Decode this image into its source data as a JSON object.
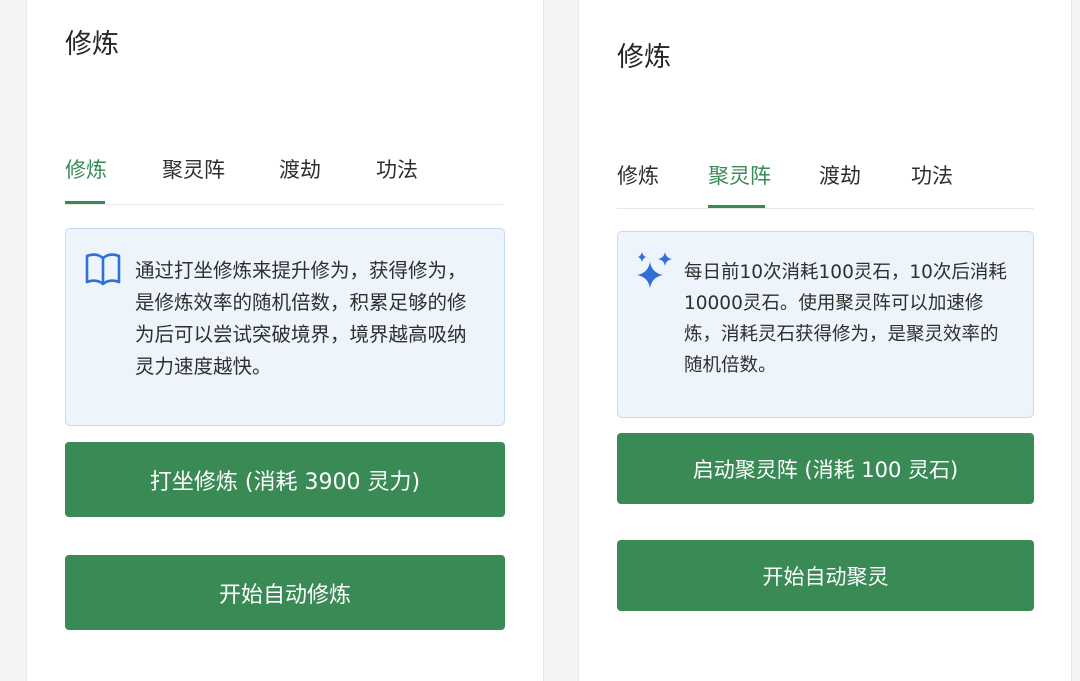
{
  "left_panel": {
    "title": "修炼",
    "tabs": [
      {
        "label": "修炼",
        "active": true
      },
      {
        "label": "聚灵阵",
        "active": false
      },
      {
        "label": "渡劫",
        "active": false
      },
      {
        "label": "功法",
        "active": false
      }
    ],
    "info": {
      "icon": "book-icon",
      "text": "通过打坐修炼来提升修为，获得修为，是修炼效率的随机倍数，积累足够的修为后可以尝试突破境界，境界越高吸纳灵力速度越快。"
    },
    "primary_button": "打坐修炼 (消耗 3900 灵力)",
    "secondary_button": "开始自动修炼"
  },
  "right_panel": {
    "title": "修炼",
    "tabs": [
      {
        "label": "修炼",
        "active": false
      },
      {
        "label": "聚灵阵",
        "active": true
      },
      {
        "label": "渡劫",
        "active": false
      },
      {
        "label": "功法",
        "active": false
      }
    ],
    "info": {
      "icon": "sparkles-icon",
      "text": "每日前10次消耗100灵石，10次后消耗10000灵石。使用聚灵阵可以加速修炼，消耗灵石获得修为，是聚灵效率的随机倍数。"
    },
    "primary_button": "启动聚灵阵 (消耗 100 灵石)",
    "secondary_button": "开始自动聚灵"
  },
  "colors": {
    "accent_green": "#3a8a56",
    "info_background": "#eef4fc",
    "info_border": "#c8daf2",
    "icon_blue": "#2f6fd6"
  }
}
